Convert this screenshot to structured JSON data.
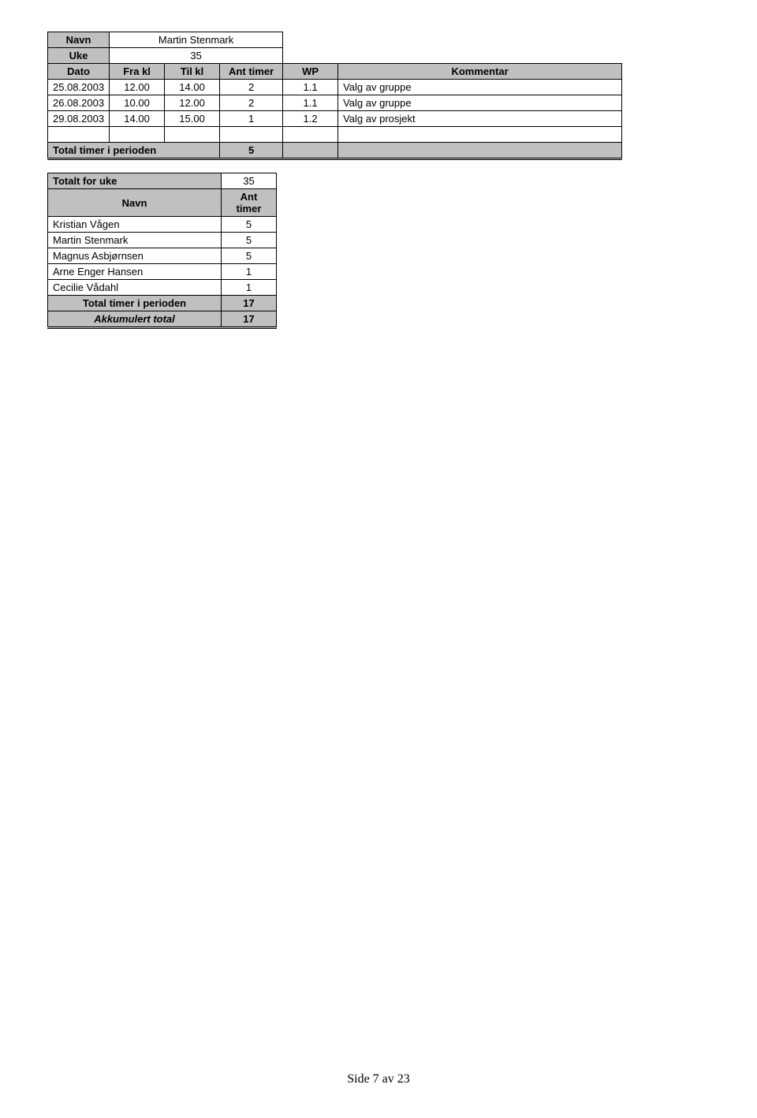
{
  "table1": {
    "labels": {
      "navn": "Navn",
      "uke": "Uke",
      "dato": "Dato",
      "frakl": "Fra kl",
      "tilkl": "Til kl",
      "anttimer": "Ant timer",
      "wp": "WP",
      "kommentar": "Kommentar"
    },
    "navn_value": "Martin Stenmark",
    "uke_value": "35",
    "rows": [
      {
        "dato": "25.08.2003",
        "fra": "12.00",
        "til": "14.00",
        "ant": "2",
        "wp": "1.1",
        "komm": "Valg av gruppe"
      },
      {
        "dato": "26.08.2003",
        "fra": "10.00",
        "til": "12.00",
        "ant": "2",
        "wp": "1.1",
        "komm": "Valg av gruppe"
      },
      {
        "dato": "29.08.2003",
        "fra": "14.00",
        "til": "15.00",
        "ant": "1",
        "wp": "1.2",
        "komm": "Valg av prosjekt"
      }
    ],
    "total_label": "Total timer i perioden",
    "total_value": "5"
  },
  "table2": {
    "title_label": "Totalt for uke",
    "title_value": "35",
    "col_navn": "Navn",
    "col_ant": "Ant timer",
    "rows": [
      {
        "navn": "Kristian Vågen",
        "ant": "5"
      },
      {
        "navn": "Martin Stenmark",
        "ant": "5"
      },
      {
        "navn": "Magnus Asbjørnsen",
        "ant": "5"
      },
      {
        "navn": "Arne Enger Hansen",
        "ant": "1"
      },
      {
        "navn": "Cecilie Vådahl",
        "ant": "1"
      }
    ],
    "total_label": "Total timer i perioden",
    "total_value": "17",
    "akkum_label": "Akkumulert total",
    "akkum_value": "17"
  },
  "footer": "Side 7 av 23"
}
